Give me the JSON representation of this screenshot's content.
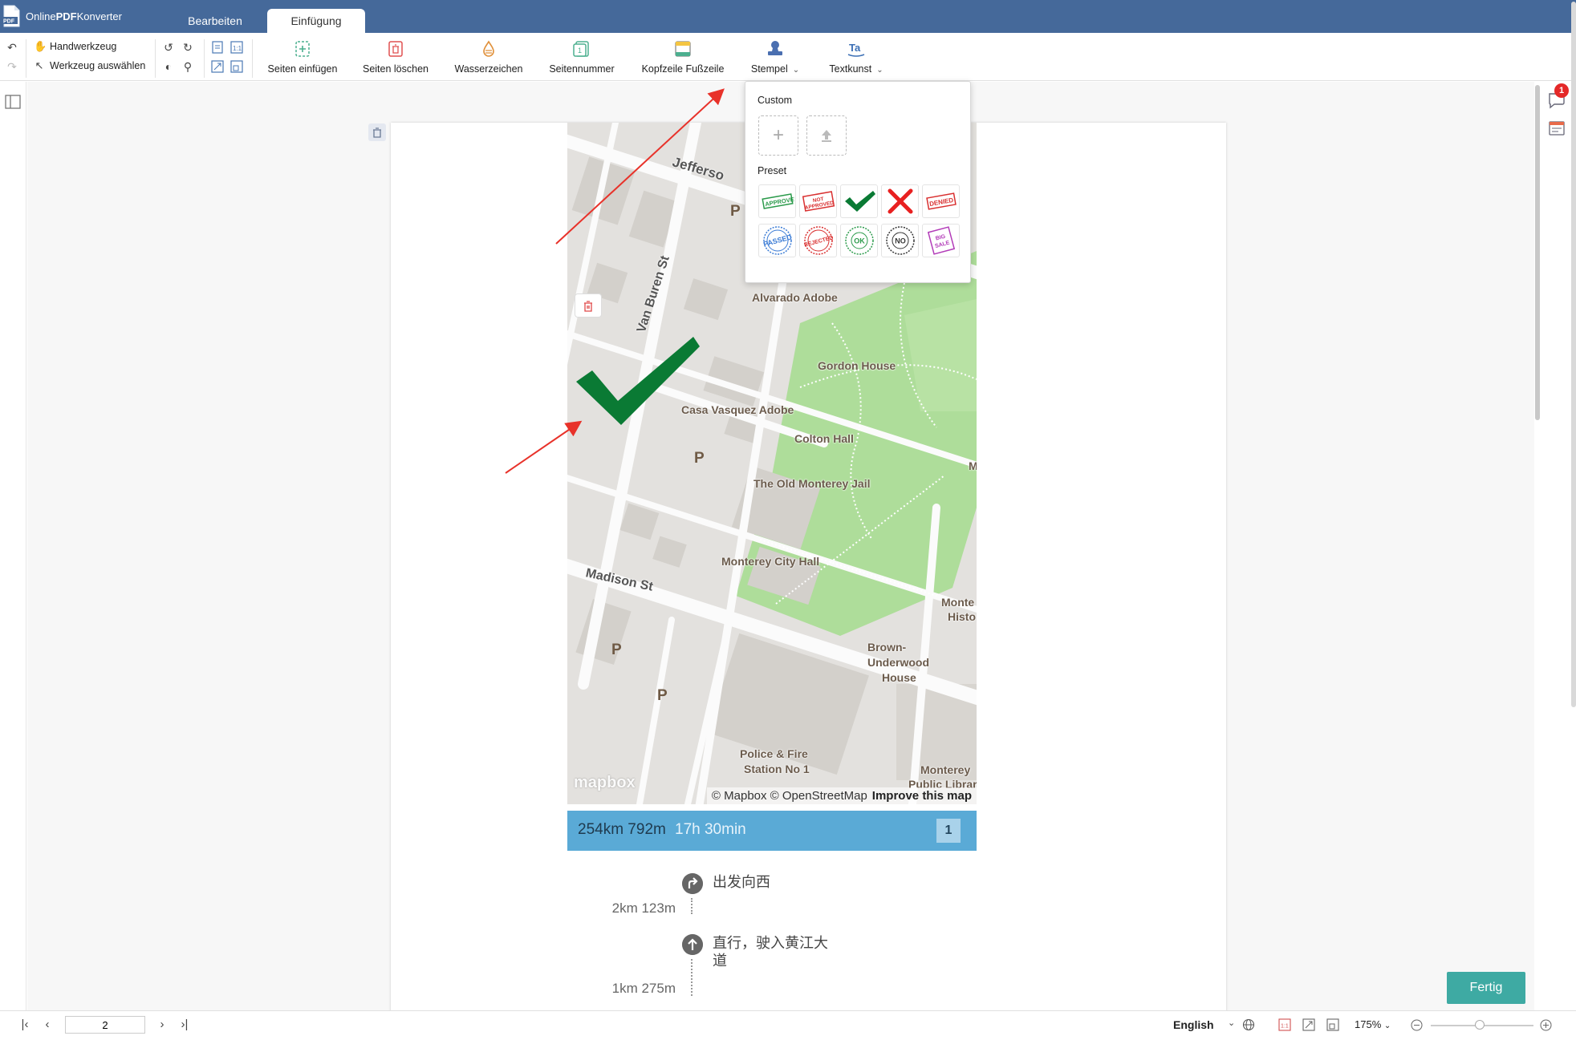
{
  "app": {
    "title_prefix": "Online",
    "title_bold": "PDF",
    "title_suffix": "Konverter"
  },
  "tabs": [
    {
      "label": "Bearbeiten",
      "active": false
    },
    {
      "label": "Einfügung",
      "active": true
    }
  ],
  "toolbar": {
    "hand_tool": "Handwerkzeug",
    "select_tool": "Werkzeug auswählen",
    "insert_pages": "Seiten einfügen",
    "delete_pages": "Seiten löschen",
    "watermark": "Wasserzeichen",
    "page_number": "Seitennummer",
    "header_footer": "Kopfzeile Fußzeile",
    "stamp": "Stempel",
    "text_art": "Textkunst"
  },
  "stamp_dropdown": {
    "custom_heading": "Custom",
    "preset_heading": "Preset",
    "presets": [
      "APPROVED",
      "NOT APPROVED",
      "CHECK",
      "CROSS",
      "DENIED",
      "PASSED",
      "REJECTED",
      "OK",
      "NO",
      "BIG SALE"
    ]
  },
  "map": {
    "labels": {
      "jefferson": "Jefferso",
      "van_buren": "Van Buren St",
      "alvarado": "Alvarado Adobe",
      "gordon": "Gordon House",
      "casa_vasquez": "Casa Vasquez Adobe",
      "colton": "Colton Hall",
      "jail": "The Old Monterey Jail",
      "city_hall": "Monterey City Hall",
      "madison": "Madison St",
      "monte_histo_1": "Monte",
      "monte_histo_2": "Histo",
      "brown_1": "Brown-",
      "brown_2": "Underwood",
      "brown_3": "House",
      "police_1": "Police & Fire",
      "police_2": "Station No 1",
      "library_1": "Monterey",
      "library_2": "Public Librar",
      "edge_m": "M",
      "parking": "P"
    },
    "logo": "mapbox",
    "attribution": "© Mapbox © OpenStreetMap",
    "improve": "Improve this map"
  },
  "route": {
    "distance": "254km 792m",
    "duration": "17h 30min",
    "number": "1",
    "steps": [
      {
        "text": "出发向西",
        "distance": "2km 123m"
      },
      {
        "text_line1": "直行，驶入黄江大",
        "text_line2": "道",
        "distance": "1km 275m"
      }
    ]
  },
  "notification_count": "1",
  "fertig": "Fertig",
  "bottom": {
    "page": "2",
    "language": "English",
    "zoom": "175%",
    "zoom_fraction": 0.48
  },
  "colors": {
    "titlebar": "#45699a",
    "accent_button": "#3eaaa3",
    "route_header": "#5aaad6",
    "checkmark": "#0a7a34",
    "annotation_arrow": "#e8322a"
  }
}
